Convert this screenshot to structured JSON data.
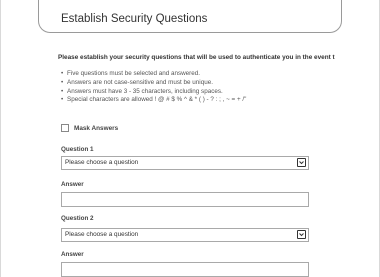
{
  "title": "Establish Security Questions",
  "intro": "Please establish your security questions that will be used to authenticate you in the event t",
  "rules": [
    "Five questions must be selected and answered.",
    "Answers are not case-sensitive and must be unique.",
    "Answers must have 3 - 35 characters, including spaces.",
    "Special characters are allowed ! @ # $ % ^ & *  ( ) - ? : ; , ~ = + /\""
  ],
  "bullet": "•",
  "mask_answers": {
    "label": "Mask Answers",
    "checked": false
  },
  "question1": {
    "label": "Question 1",
    "selected": "Please choose a question",
    "answer_label": "Answer",
    "answer_value": ""
  },
  "question2": {
    "label": "Question 2",
    "selected": "Please choose a question",
    "answer_label": "Answer",
    "answer_value": ""
  },
  "icons": {
    "dropdown": "chevron-down-icon",
    "checkbox": "checkbox-icon"
  }
}
